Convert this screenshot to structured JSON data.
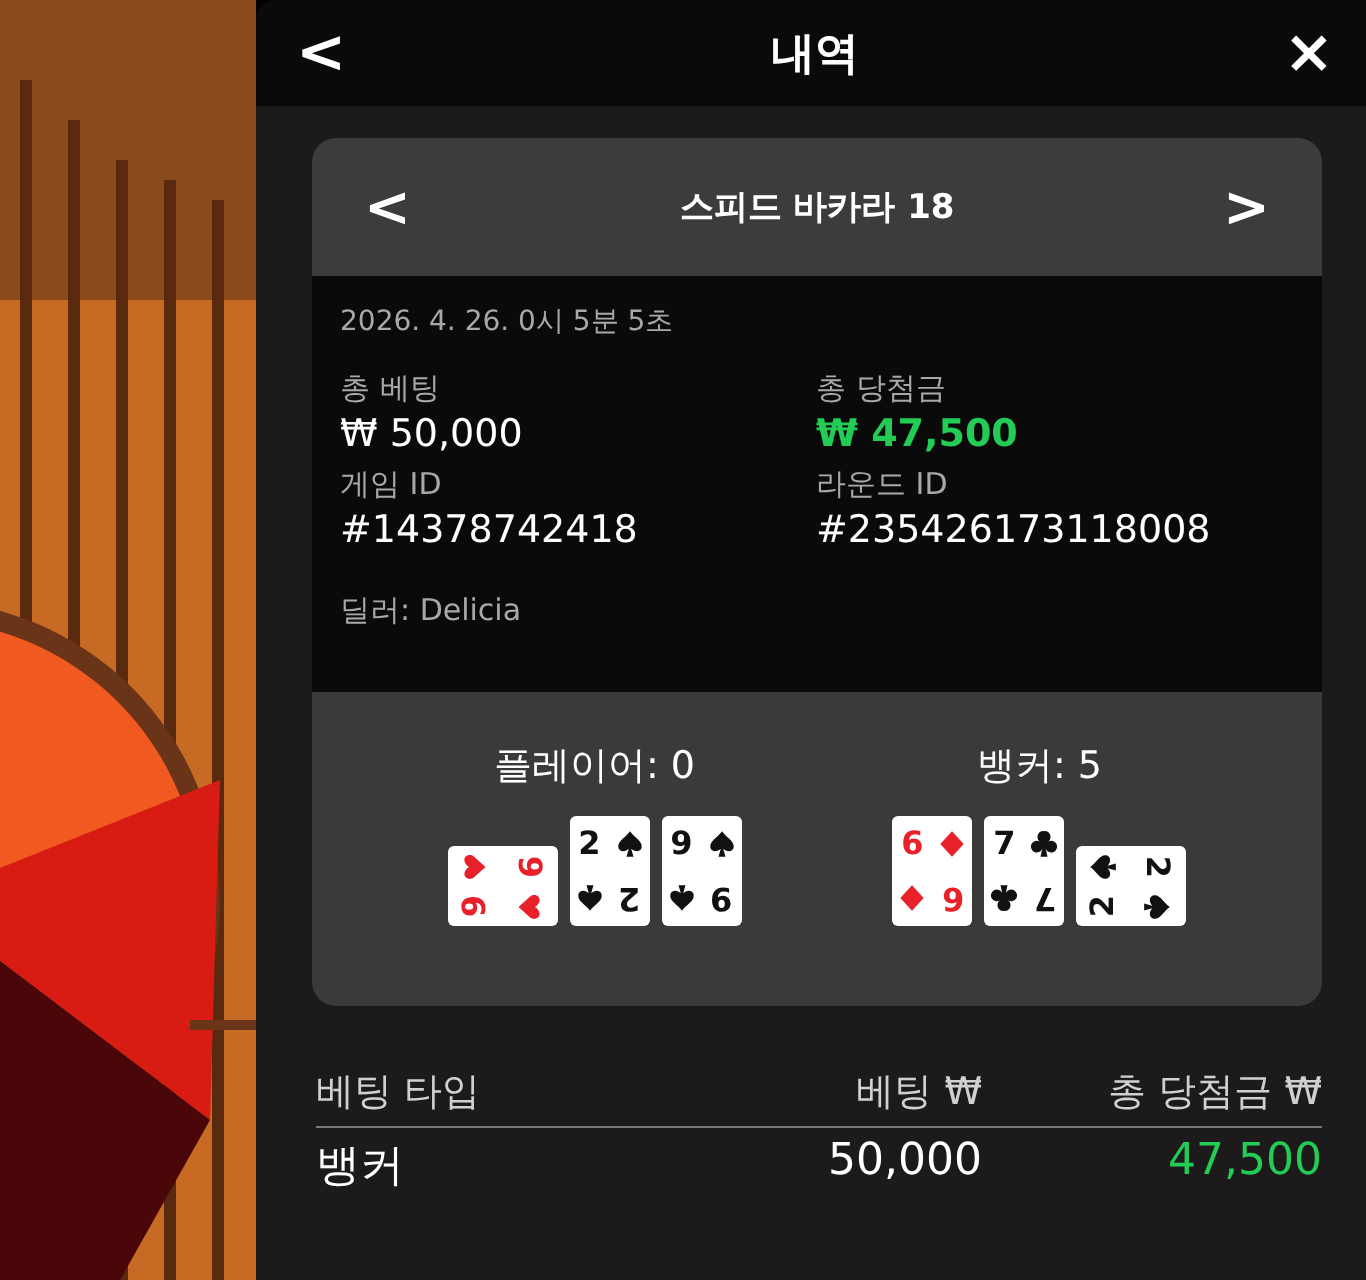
{
  "header": {
    "back": "<",
    "title": "내역",
    "close": "×"
  },
  "game": {
    "prev": "<",
    "title": "스피드 바카라 18",
    "next": ">"
  },
  "details": {
    "datetime": "2026. 4. 26. 0시 5분 5초",
    "fields": [
      {
        "label": "총 베팅",
        "value": "₩ 50,000",
        "highlight": false
      },
      {
        "label": "총 당첨금",
        "value": "₩ 47,500",
        "highlight": true
      },
      {
        "label": "게임 ID",
        "value": "#14378742418",
        "highlight": false
      },
      {
        "label": "라운드 ID",
        "value": "#235426173118008",
        "highlight": false
      }
    ],
    "dealer": "딜러: Delicia"
  },
  "hands": [
    {
      "title": "플레이어: 0",
      "cards": [
        {
          "kind": "heart",
          "sideways": true,
          "ranks": [
            "9",
            "9"
          ]
        },
        {
          "kind": "spade",
          "sideways": false,
          "ranks": [
            "2",
            "2"
          ]
        },
        {
          "kind": "spade",
          "sideways": false,
          "ranks": [
            "9",
            "9"
          ]
        }
      ]
    },
    {
      "title": "뱅커: 5",
      "cards": [
        {
          "kind": "diamond",
          "sideways": false,
          "ranks": [
            "6",
            "6"
          ]
        },
        {
          "kind": "club",
          "sideways": false,
          "ranks": [
            "7",
            "7"
          ]
        },
        {
          "kind": "spade",
          "sideways": true,
          "ranks": [
            "2",
            "2"
          ]
        }
      ]
    }
  ],
  "table": {
    "columns": [
      "베팅 타입",
      "베팅 ₩",
      "총 당첨금 ₩"
    ],
    "rows": [
      {
        "cells": [
          "뱅커",
          "50,000",
          "47,500"
        ],
        "win": true
      }
    ]
  }
}
